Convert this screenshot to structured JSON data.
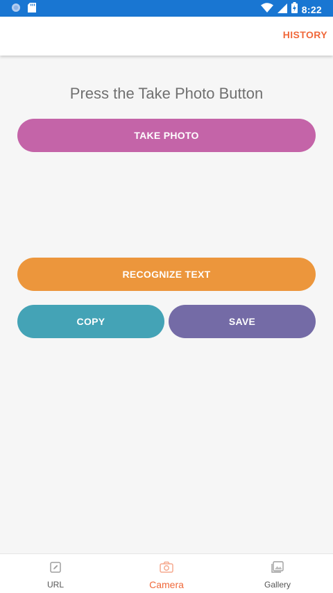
{
  "status_bar": {
    "time": "8:22",
    "icons": [
      "circle-notification-icon",
      "sd-card-icon",
      "wifi-icon",
      "signal-icon",
      "battery-charging-icon"
    ],
    "background": "#1976d2"
  },
  "app_bar": {
    "history_label": "HISTORY"
  },
  "main": {
    "prompt": "Press the Take Photo Button",
    "take_photo_label": "TAKE PHOTO",
    "recognize_label": "RECOGNIZE TEXT",
    "copy_label": "COPY",
    "save_label": "SAVE"
  },
  "colors": {
    "accent": "#f0683a",
    "take_photo": "#c464a8",
    "recognize": "#ec963c",
    "copy": "#44a3b6",
    "save": "#746ba6"
  },
  "bottom_nav": {
    "items": [
      {
        "label": "URL",
        "icon": "edit-icon",
        "active": false
      },
      {
        "label": "Camera",
        "icon": "camera-icon",
        "active": true
      },
      {
        "label": "Gallery",
        "icon": "gallery-icon",
        "active": false
      }
    ]
  }
}
